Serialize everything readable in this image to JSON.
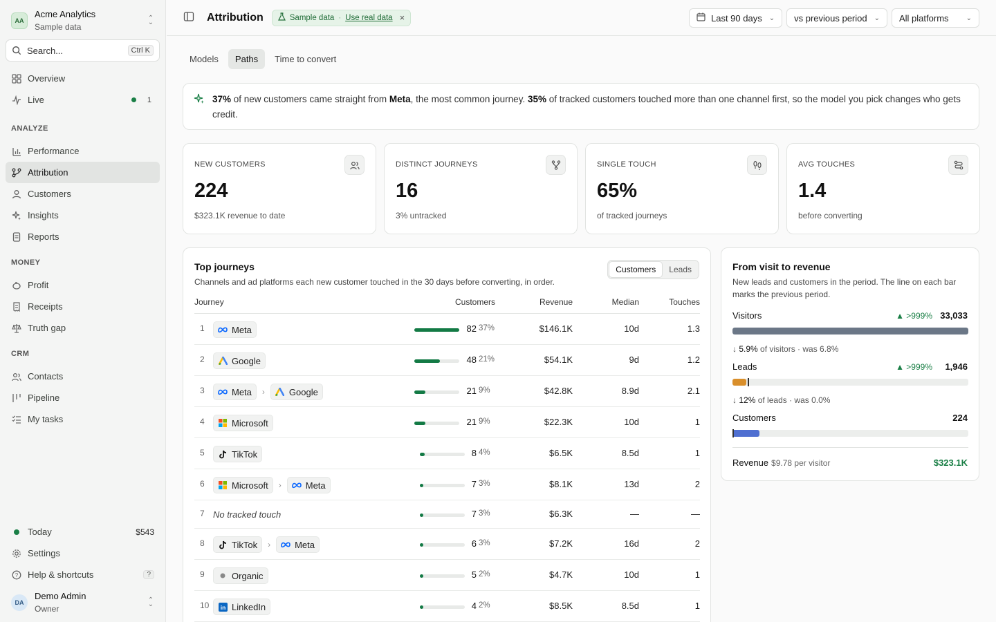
{
  "org": {
    "initials": "AA",
    "name": "Acme Analytics",
    "sub": "Sample data"
  },
  "search": {
    "placeholder": "Search...",
    "shortcut": "Ctrl K"
  },
  "nav_top": [
    {
      "label": "Overview",
      "icon": "grid-icon"
    },
    {
      "label": "Live",
      "icon": "pulse-icon",
      "count": "1"
    }
  ],
  "sections": {
    "analyze": "ANALYZE",
    "money": "MONEY",
    "crm": "CRM"
  },
  "nav_analyze": [
    {
      "label": "Performance",
      "icon": "bar-chart-icon"
    },
    {
      "label": "Attribution",
      "icon": "branch-icon",
      "active": true
    },
    {
      "label": "Customers",
      "icon": "user-icon"
    },
    {
      "label": "Insights",
      "icon": "sparkle-icon"
    },
    {
      "label": "Reports",
      "icon": "document-icon"
    }
  ],
  "nav_money": [
    {
      "label": "Profit",
      "icon": "piggy-icon"
    },
    {
      "label": "Receipts",
      "icon": "receipt-icon"
    },
    {
      "label": "Truth gap",
      "icon": "scale-icon"
    }
  ],
  "nav_crm": [
    {
      "label": "Contacts",
      "icon": "users-icon"
    },
    {
      "label": "Pipeline",
      "icon": "pipeline-icon"
    },
    {
      "label": "My tasks",
      "icon": "checklist-icon"
    }
  ],
  "footer_nav": {
    "today": {
      "label": "Today",
      "value": "$543"
    },
    "settings": "Settings",
    "help": {
      "label": "Help & shortcuts",
      "key": "?"
    }
  },
  "user": {
    "initials": "DA",
    "name": "Demo Admin",
    "role": "Owner"
  },
  "header": {
    "title": "Attribution",
    "sample_label": "Sample data",
    "sample_sep": "·",
    "use_real": "Use real data",
    "date_range": "Last 90 days",
    "compare": "vs previous period",
    "platforms": "All platforms"
  },
  "tabs": [
    "Models",
    "Paths",
    "Time to convert"
  ],
  "insight": {
    "p1": "37%",
    "t1": " of new customers came straight from ",
    "p2": "Meta",
    "t2": ", the most common journey. ",
    "p3": "35%",
    "t3": " of tracked customers touched more than one channel first, so the model you pick changes who gets credit."
  },
  "kpis": [
    {
      "label": "NEW CUSTOMERS",
      "value": "224",
      "sub": "$323.1K revenue to date",
      "icon": "users-icon"
    },
    {
      "label": "DISTINCT JOURNEYS",
      "value": "16",
      "sub": "3% untracked",
      "icon": "fork-icon"
    },
    {
      "label": "SINGLE TOUCH",
      "value": "65%",
      "sub": "of tracked journeys",
      "icon": "footprints-icon"
    },
    {
      "label": "AVG TOUCHES",
      "value": "1.4",
      "sub": "before converting",
      "icon": "route-icon"
    }
  ],
  "journeys": {
    "title": "Top journeys",
    "subtitle": "Channels and ad platforms each new customer touched in the 30 days before converting, in order.",
    "toggle": [
      "Customers",
      "Leads"
    ],
    "columns": {
      "journey": "Journey",
      "customers": "Customers",
      "revenue": "Revenue",
      "median": "Median",
      "touches": "Touches"
    },
    "rows": [
      {
        "n": "1",
        "path": [
          "Meta"
        ],
        "customers": "82",
        "share": 0.37,
        "pct": "37%",
        "revenue": "$146.1K",
        "median": "10d",
        "touches": "1.3"
      },
      {
        "n": "2",
        "path": [
          "Google"
        ],
        "customers": "48",
        "share": 0.21,
        "pct": "21%",
        "revenue": "$54.1K",
        "median": "9d",
        "touches": "1.2"
      },
      {
        "n": "3",
        "path": [
          "Meta",
          "Google"
        ],
        "customers": "21",
        "share": 0.09,
        "pct": "9%",
        "revenue": "$42.8K",
        "median": "8.9d",
        "touches": "2.1"
      },
      {
        "n": "4",
        "path": [
          "Microsoft"
        ],
        "customers": "21",
        "share": 0.09,
        "pct": "9%",
        "revenue": "$22.3K",
        "median": "10d",
        "touches": "1"
      },
      {
        "n": "5",
        "path": [
          "TikTok"
        ],
        "customers": "8",
        "share": 0.04,
        "pct": "4%",
        "revenue": "$6.5K",
        "median": "8.5d",
        "touches": "1"
      },
      {
        "n": "6",
        "path": [
          "Microsoft",
          "Meta"
        ],
        "customers": "7",
        "share": 0.03,
        "pct": "3%",
        "revenue": "$8.1K",
        "median": "13d",
        "touches": "2"
      },
      {
        "n": "7",
        "path": [],
        "untracked": "No tracked touch",
        "customers": "7",
        "share": 0.03,
        "pct": "3%",
        "revenue": "$6.3K",
        "median": "—",
        "touches": "—"
      },
      {
        "n": "8",
        "path": [
          "TikTok",
          "Meta"
        ],
        "customers": "6",
        "share": 0.03,
        "pct": "3%",
        "revenue": "$7.2K",
        "median": "16d",
        "touches": "2"
      },
      {
        "n": "9",
        "path": [
          "Organic"
        ],
        "customers": "5",
        "share": 0.02,
        "pct": "2%",
        "revenue": "$4.7K",
        "median": "10d",
        "touches": "1"
      },
      {
        "n": "10",
        "path": [
          "LinkedIn"
        ],
        "customers": "4",
        "share": 0.02,
        "pct": "2%",
        "revenue": "$8.5K",
        "median": "8.5d",
        "touches": "1"
      }
    ]
  },
  "funnel": {
    "title": "From visit to revenue",
    "subtitle": "New leads and customers in the period. The line on each bar marks the previous period.",
    "visitors": {
      "label": "Visitors",
      "delta": ">999%",
      "value": "33,033",
      "fill": 1.0,
      "color": "#6b7787"
    },
    "conv1": {
      "pct": "5.9%",
      "text": " of visitors · was 6.8%"
    },
    "leads": {
      "label": "Leads",
      "delta": ">999%",
      "value": "1,946",
      "fill": 0.059,
      "prev": 0.065,
      "color": "#d98f2b"
    },
    "conv2": {
      "pct": "12%",
      "text": " of leads · was 0.0%"
    },
    "customers": {
      "label": "Customers",
      "value": "224",
      "fill": 0.115,
      "prev": 0.0,
      "color": "#4f6fd1"
    },
    "revenue": {
      "label": "Revenue",
      "sub": "$9.78 per visitor",
      "value": "$323.1K"
    }
  },
  "colors": {
    "accent": "#137a45",
    "meta": "#0866ff",
    "google": "#4285f4",
    "linkedin": "#0a66c2"
  }
}
